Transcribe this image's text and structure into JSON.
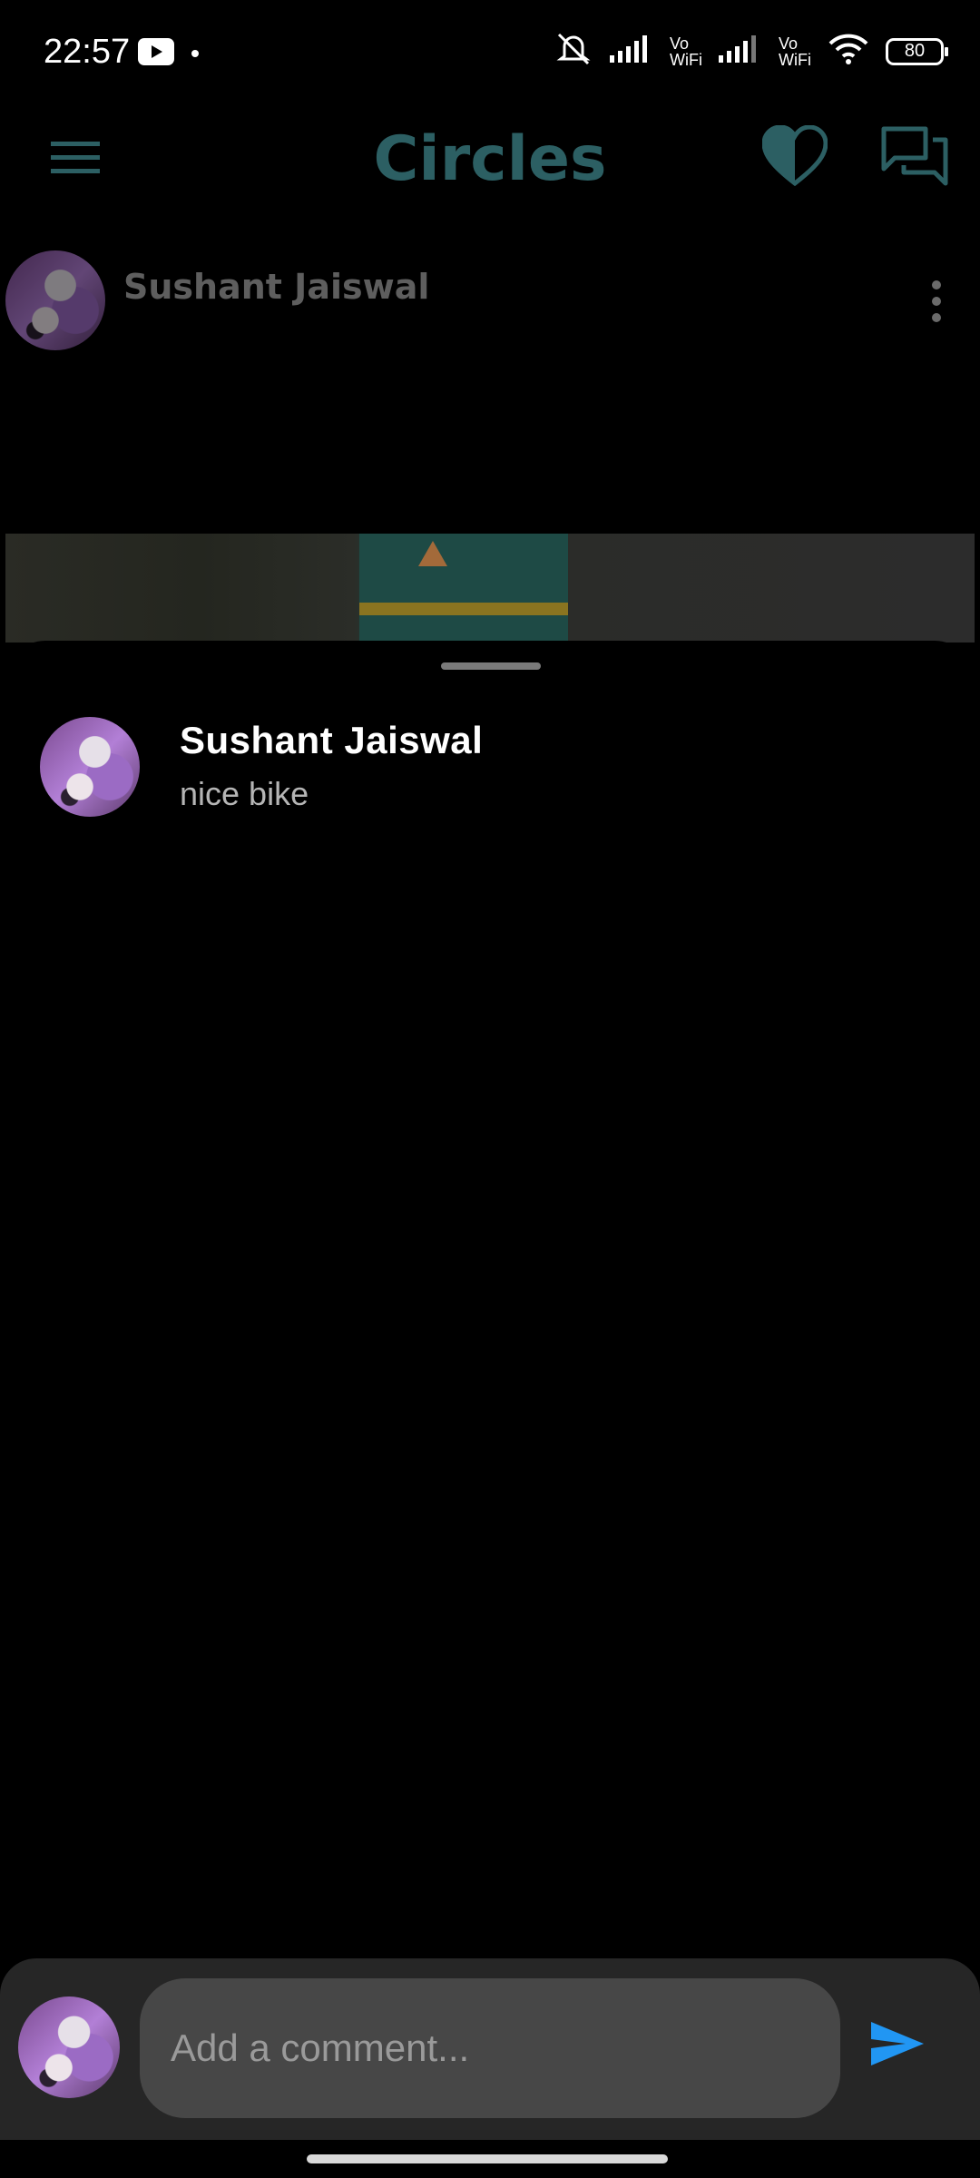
{
  "status_bar": {
    "time": "22:57",
    "icons": [
      "youtube-icon",
      "dot-icon",
      "mute-icon",
      "signal-icon",
      "vowifi-icon",
      "signal-icon",
      "vowifi-icon",
      "wifi-icon",
      "battery-icon"
    ],
    "vowifi_top": "Vo",
    "vowifi_bottom": "WiFi",
    "battery_level": "80"
  },
  "header": {
    "title": "Circles",
    "accent_color": "#2c5f63"
  },
  "post": {
    "author": "Sushant Jaiswal"
  },
  "comments": [
    {
      "author": "Sushant Jaiswal",
      "text": "nice bike"
    }
  ],
  "comment_input": {
    "placeholder": "Add a comment...",
    "value": ""
  },
  "send": {
    "color": "#2196f3"
  }
}
